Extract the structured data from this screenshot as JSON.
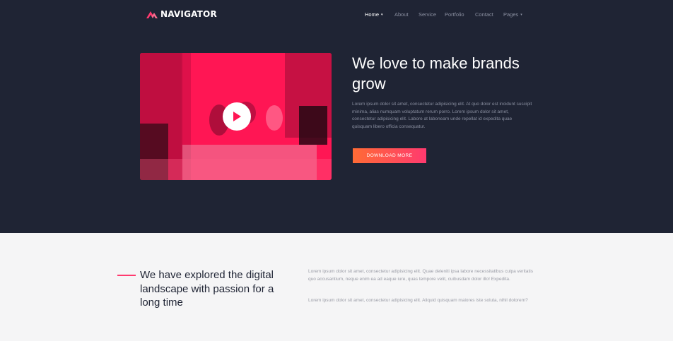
{
  "brand": {
    "name": "NAVIGATOR",
    "logo_icon": "mountain-logo-icon",
    "accent": "#ff3a6f"
  },
  "nav": {
    "items": [
      {
        "label": "Home",
        "active": true,
        "has_dropdown": true
      },
      {
        "label": "About",
        "active": false,
        "has_dropdown": false
      },
      {
        "label": "Service",
        "active": false,
        "has_dropdown": false
      },
      {
        "label": "Portfolio",
        "active": false,
        "has_dropdown": false
      },
      {
        "label": "Contact",
        "active": false,
        "has_dropdown": false
      },
      {
        "label": "Pages",
        "active": false,
        "has_dropdown": true
      }
    ],
    "caret": "▾"
  },
  "hero": {
    "title": "We love to make brands grow",
    "text": "Lorem ipsum dolor sit amet, consectetur adipisicing elit. At quo dolor est incidunt suscipit minima, alias numquam voluptatum rerum porro. Lorem ipsum dolor sit amet, consectetur adipisicing elit. Labore at laboneam unde repellat id expedita quae quisquam libero officia consequatur.",
    "button_label": "DOWNLOAD MORE",
    "video_icon": "play-icon",
    "background": "#1f2434",
    "video_tint": "#ff1654"
  },
  "about": {
    "title": "We have explored the digital landscape with passion for a long time",
    "paragraph1": "Lorem ipsum dolor sit amet, consectetur adipisicing elit. Quae deleniti ipsa labore necessitatibus culpa veritatis quo accusantium, neque enim ea ad eaque iure, quas tempore velit, cuibusdam dolor illo! Expedita.",
    "paragraph2": "Lorem ipsum dolor sit amet, consectetur adipisicing elit. Aliquid quisquam maiores iste soluta, nihil dolorem?"
  }
}
